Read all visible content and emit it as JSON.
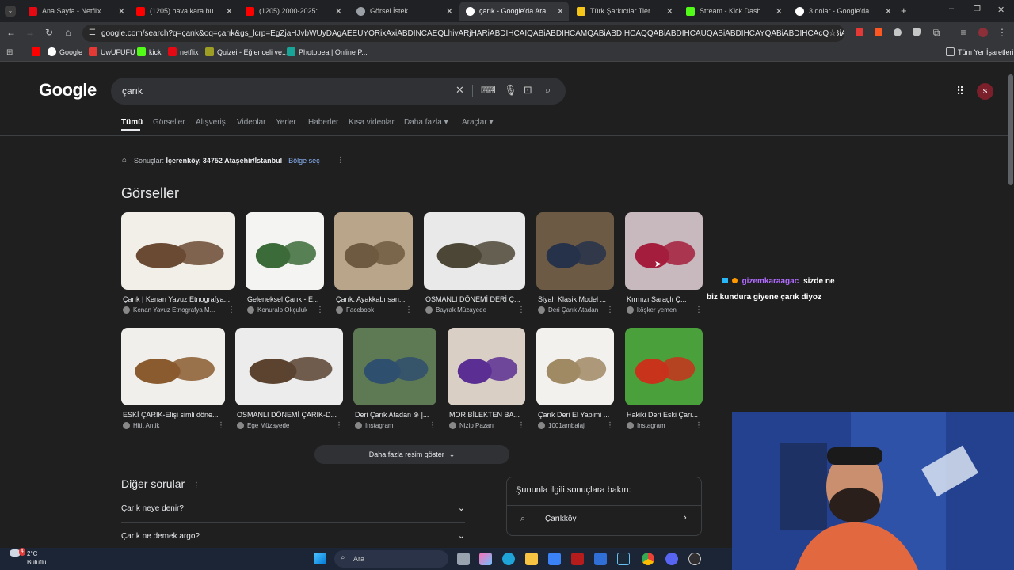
{
  "browser": {
    "tabs": [
      {
        "title": "Ana Sayfa - Netflix",
        "color": "#e50914"
      },
      {
        "title": "(1205) hava kara bulutlu y",
        "color": "#ff0000"
      },
      {
        "title": "(1205) 2000-2025: Her Yıl",
        "color": "#ff0000"
      },
      {
        "title": "Görsel İstek",
        "color": "#9aa0a6"
      },
      {
        "title": "çarık - Google'da Ara",
        "color": "#8ab4f8"
      },
      {
        "title": "Türk Şarkıcılar Tier List (C",
        "color": "#f5c518"
      },
      {
        "title": "Stream - Kick Dashboard",
        "color": "#53fc18"
      },
      {
        "title": "3 dolar - Google'da Ara",
        "color": "#8ab4f8"
      }
    ],
    "url": "google.com/search?q=çarık&oq=çarık&gs_lcrp=EgZjaHJvbWUyDAgAEEUYORixAxiABDINCAEQLhivARjHARiABDIHCAIQABiABDIHCAMQABiABDIHCAQQABiABDIHCAUQABiABDIHCAYQABiABDIHCAcQABiABDIHCAgQABiP...",
    "bookmarks": [
      {
        "label": "",
        "color": "#ff0000"
      },
      {
        "label": "Google",
        "color": "#4285f4"
      },
      {
        "label": "UwUFUFU",
        "color": "#e53935"
      },
      {
        "label": "kick",
        "color": "#53fc18"
      },
      {
        "label": "netflix",
        "color": "#e50914"
      },
      {
        "label": "Quizei - Eğlenceli ve...",
        "color": "#9e9d24"
      },
      {
        "label": "Photopea | Online P...",
        "color": "#18a497"
      }
    ],
    "all_bookmarks": "Tüm Yer İşaretleri"
  },
  "google": {
    "logo": "Google",
    "query": "çarık",
    "avatar_letter": "s",
    "nav_tabs": [
      "Tümü",
      "Görseller",
      "Alışveriş",
      "Videolar",
      "Yerler",
      "Haberler",
      "Kısa videolar",
      "Daha fazla ▾",
      "Araçlar ▾"
    ],
    "results_prefix": "Sonuçlar:",
    "location": "İçerenköy, 34752 Ataşehir/İstanbul",
    "location_sep": "·",
    "region_link": "Bölge seç",
    "images_heading": "Görseller",
    "images_row1": [
      {
        "caption": "Çarık | Kenan Yavuz Etnografya...",
        "source": "Kenan Yavuz Etnografya M...",
        "bg": "#f2efe9",
        "fg": "#6b4a34"
      },
      {
        "caption": "Geleneksel Çarık - E...",
        "source": "Konuralp Okçuluk",
        "bg": "#f4f4f2",
        "fg": "#3c6b3a"
      },
      {
        "caption": "Çarık. Ayakkabı san...",
        "source": "Facebook",
        "bg": "#b9a68a",
        "fg": "#6e5a40"
      },
      {
        "caption": "OSMANLI DÖNEMİ DERİ Ç...",
        "source": "Bayrak Müzayede",
        "bg": "#e9e9e9",
        "fg": "#4c4636"
      },
      {
        "caption": "Siyah Klasik Model ...",
        "source": "Deri Çarık Atadan",
        "bg": "#6d5a44",
        "fg": "#26324a"
      },
      {
        "caption": "Kırmızı Saraçlı Ç...",
        "source": "köşker yemeni",
        "bg": "#c7b9bd",
        "fg": "#a51d3c"
      }
    ],
    "images_row2": [
      {
        "caption": "ESKİ ÇARIK-Elişi simli döne...",
        "source": "Hitit Antik",
        "bg": "#f1efec",
        "fg": "#8a5b2e"
      },
      {
        "caption": "OSMANLI DÖNEMİ ÇARIK-D...",
        "source": "Ege Müzayede",
        "bg": "#ececec",
        "fg": "#5b4330"
      },
      {
        "caption": "Deri Çarık Atadan ⊛ |...",
        "source": "Instagram",
        "bg": "#5e7a54",
        "fg": "#2f4f6e"
      },
      {
        "caption": "MOR BİLEKTEN BA...",
        "source": "Nizip Pazarı",
        "bg": "#d9cfc4",
        "fg": "#5a2e93"
      },
      {
        "caption": "Çarık Deri El Yapimi ...",
        "source": "1001ambalaj",
        "bg": "#f3f1ee",
        "fg": "#a08a64"
      },
      {
        "caption": "Hakiki Deri Eski Çarı...",
        "source": "Instagram",
        "bg": "#4aa13c",
        "fg": "#c8331c"
      }
    ],
    "more_images": "Daha fazla resim göster",
    "other_questions_heading": "Diğer sorular",
    "questions": [
      "Çarık neye denir?",
      "Çarık ne demek argo?"
    ],
    "related_heading": "Şununla ilgili sonuçlara bakın:",
    "related_item": "Çarıkköy"
  },
  "chat_overlay": {
    "user": "gizemkaraagac",
    "line1": "sizde ne",
    "line2": "biz kundura giyene çarık diyoz"
  },
  "taskbar": {
    "temperature": "2°C",
    "weather": "Bulutlu",
    "weather_badge": "4",
    "search_placeholder": "Ara"
  }
}
